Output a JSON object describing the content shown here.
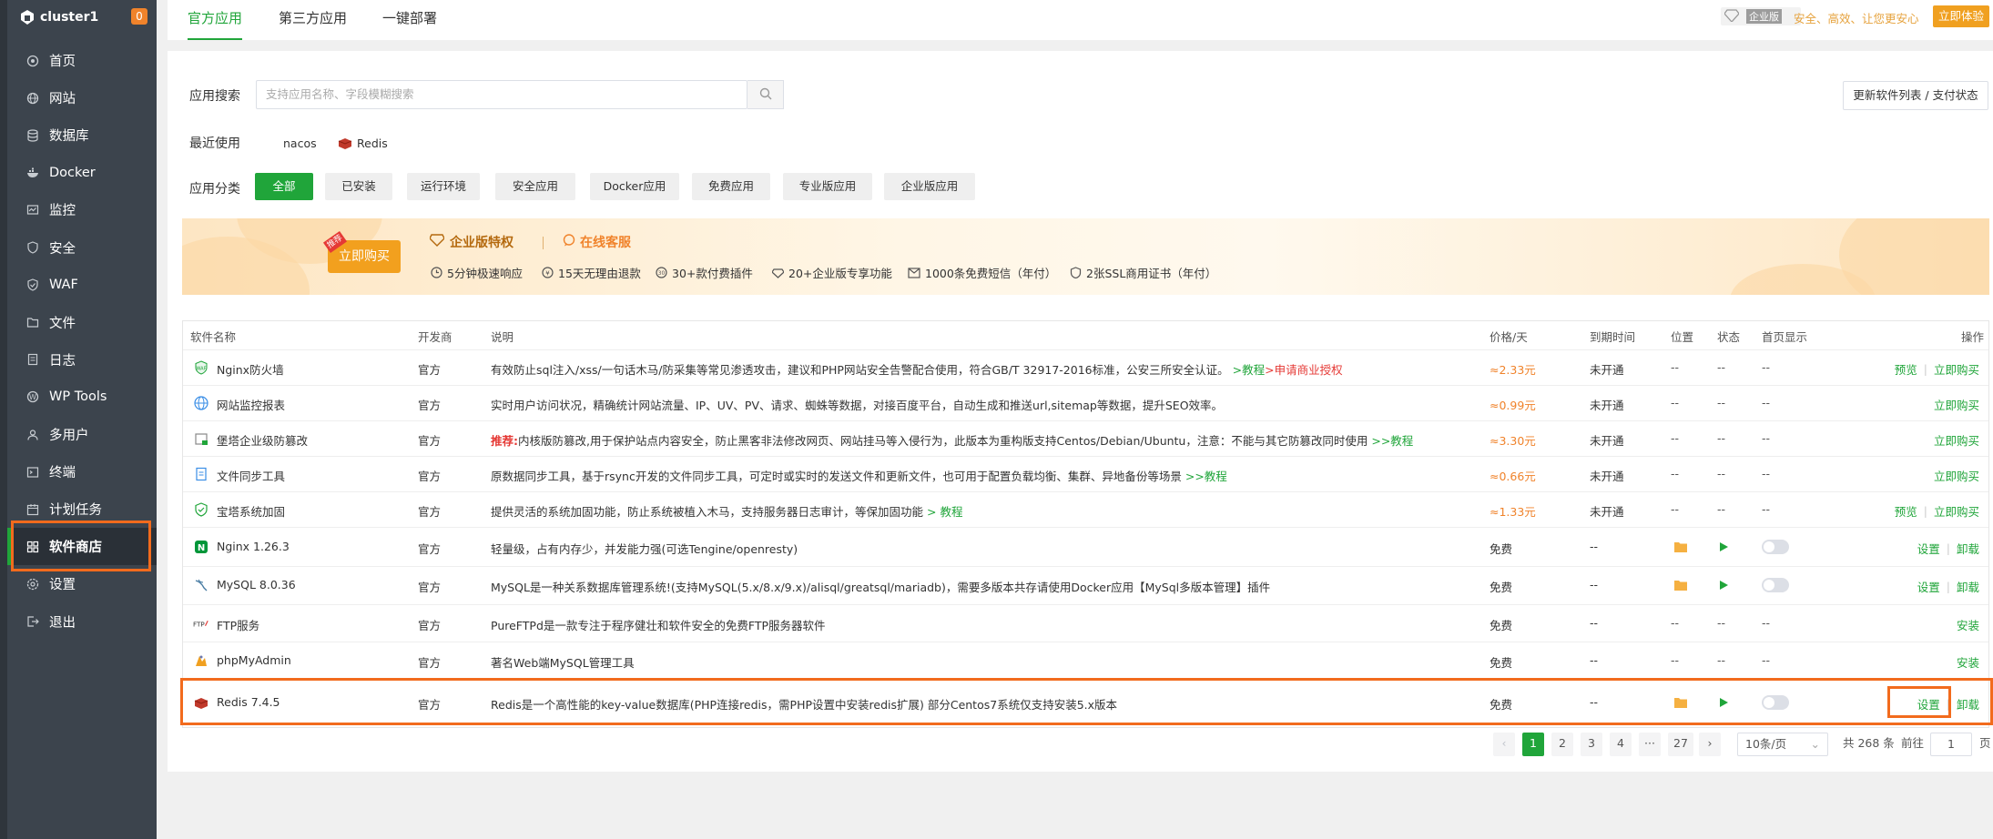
{
  "sidebar": {
    "cluster": "cluster1",
    "badge": "0",
    "items": [
      {
        "label": "首页",
        "icon": "home-icon"
      },
      {
        "label": "网站",
        "icon": "globe-icon"
      },
      {
        "label": "数据库",
        "icon": "database-icon"
      },
      {
        "label": "Docker",
        "icon": "docker-icon"
      },
      {
        "label": "监控",
        "icon": "monitor-icon"
      },
      {
        "label": "安全",
        "icon": "shield-icon"
      },
      {
        "label": "WAF",
        "icon": "waf-icon"
      },
      {
        "label": "文件",
        "icon": "folder-icon"
      },
      {
        "label": "日志",
        "icon": "log-icon"
      },
      {
        "label": "WP Tools",
        "icon": "wordpress-icon"
      },
      {
        "label": "多用户",
        "icon": "users-icon"
      },
      {
        "label": "终端",
        "icon": "terminal-icon"
      },
      {
        "label": "计划任务",
        "icon": "calendar-icon"
      },
      {
        "label": "软件商店",
        "icon": "grid-icon"
      },
      {
        "label": "设置",
        "icon": "gear-icon"
      },
      {
        "label": "退出",
        "icon": "logout-icon"
      }
    ]
  },
  "topbar": {
    "tabs": [
      "官方应用",
      "第三方应用",
      "一键部署"
    ],
    "enterprise_badge": "企业版",
    "slogan": "安全、高效、让您更安心",
    "trial_button": "立即体验"
  },
  "search": {
    "label": "应用搜索",
    "placeholder": "支持应用名称、字段模糊搜索",
    "refresh_button": "更新软件列表 / 支付状态"
  },
  "recent": {
    "label": "最近使用",
    "items": [
      "nacos",
      "Redis"
    ]
  },
  "categories": {
    "label": "应用分类",
    "items": [
      "全部",
      "已安装",
      "运行环境",
      "安全应用",
      "Docker应用",
      "免费应用",
      "专业版应用",
      "企业版应用"
    ]
  },
  "banner": {
    "buy_button": "立即购买",
    "hot_tag": "推荐",
    "privilege": "企业版特权",
    "service": "在线客服",
    "perks": [
      "5分钟极速响应",
      "15天无理由退款",
      "30+款付费插件",
      "20+企业版专享功能",
      "1000条免费短信（年付）",
      "2张SSL商用证书（年付）"
    ]
  },
  "table": {
    "headers": [
      "软件名称",
      "开发商",
      "说明",
      "价格/天",
      "到期时间",
      "位置",
      "状态",
      "首页显示",
      "操作"
    ],
    "rows": [
      {
        "name": "Nginx防火墙",
        "vendor": "官方",
        "desc": "有效防止sql注入/xss/一句话木马/防采集等常见渗透攻击，建议和PHP网站安全告警配合使用，符合GB/T 32917-2016标准，公安三所安全认证。",
        "link1": ">教程",
        "link2": ">申请商业授权",
        "price": "≈2.33元",
        "expire": "未开通",
        "loc": "--",
        "status": "--",
        "home": "--",
        "actions": [
          "预览",
          "立即购买"
        ]
      },
      {
        "name": "网站监控报表",
        "vendor": "官方",
        "desc": "实时用户访问状况，精确统计网站流量、IP、UV、PV、请求、蜘蛛等数据，对接百度平台，自动生成和推送url,sitemap等数据，提升SEO效率。",
        "price": "≈0.99元",
        "expire": "未开通",
        "loc": "--",
        "status": "--",
        "home": "--",
        "actions": [
          "立即购买"
        ]
      },
      {
        "name": "堡塔企业级防篡改",
        "vendor": "官方",
        "prefix": "推荐:",
        "desc": "内核版防篡改,用于保护站点内容安全，防止黑客非法修改网页、网站挂马等入侵行为，此版本为重构版支持Centos/Debian/Ubuntu，注意：不能与其它防篡改同时使用",
        "link1": ">>教程",
        "price": "≈3.30元",
        "expire": "未开通",
        "loc": "--",
        "status": "--",
        "home": "--",
        "actions": [
          "立即购买"
        ]
      },
      {
        "name": "文件同步工具",
        "vendor": "官方",
        "desc": "原数据同步工具，基于rsync开发的文件同步工具，可定时或实时的发送文件和更新文件，也可用于配置负载均衡、集群、异地备份等场景",
        "link1": ">>教程",
        "price": "≈0.66元",
        "expire": "未开通",
        "loc": "--",
        "status": "--",
        "home": "--",
        "actions": [
          "立即购买"
        ]
      },
      {
        "name": "宝塔系统加固",
        "vendor": "官方",
        "desc": "提供灵活的系统加固功能，防止系统被植入木马，支持服务器日志审计，等保加固功能",
        "link1": "> 教程",
        "price": "≈1.33元",
        "expire": "未开通",
        "loc": "--",
        "status": "--",
        "home": "--",
        "actions": [
          "预览",
          "立即购买"
        ]
      },
      {
        "name": "Nginx 1.26.3",
        "vendor": "官方",
        "desc": "轻量级，占有内存少，并发能力强(可选Tengine/openresty)",
        "price": "免费",
        "expire": "--",
        "loc": "",
        "status": "",
        "home": "",
        "actions": [
          "设置",
          "卸载"
        ]
      },
      {
        "name": "MySQL 8.0.36",
        "vendor": "官方",
        "desc": "MySQL是一种关系数据库管理系统!(支持MySQL(5.x/8.x/9.x)/alisql/greatsql/mariadb)，需要多版本共存请使用Docker应用【MySql多版本管理】插件",
        "price": "免费",
        "expire": "--",
        "loc": "",
        "status": "",
        "home": "",
        "actions": [
          "设置",
          "卸载"
        ]
      },
      {
        "name": "FTP服务",
        "vendor": "官方",
        "desc": "PureFTPd是一款专注于程序健壮和软件安全的免费FTP服务器软件",
        "price": "免费",
        "expire": "--",
        "loc": "--",
        "status": "--",
        "home": "--",
        "actions": [
          "安装"
        ]
      },
      {
        "name": "phpMyAdmin",
        "vendor": "官方",
        "desc": "著名Web端MySQL管理工具",
        "price": "免费",
        "expire": "--",
        "loc": "--",
        "status": "--",
        "home": "--",
        "actions": [
          "安装"
        ]
      },
      {
        "name": "Redis 7.4.5",
        "vendor": "官方",
        "desc": "Redis是一个高性能的key-value数据库(PHP连接redis，需PHP设置中安装redis扩展) 部分Centos7系统仅支持安装5.x版本",
        "price": "免费",
        "expire": "--",
        "loc": "",
        "status": "",
        "home": "",
        "actions": [
          "设置",
          "卸载"
        ]
      }
    ]
  },
  "pagination": {
    "pages": [
      "1",
      "2",
      "3",
      "4",
      "···",
      "27"
    ],
    "page_size": "10条/页",
    "total": "共 268 条",
    "goto": "前往",
    "goto_value": "1",
    "page_suffix": "页"
  },
  "colors": {
    "accent": "#20a53a",
    "highlight": "#f26b1d",
    "price": "#f0832b"
  }
}
